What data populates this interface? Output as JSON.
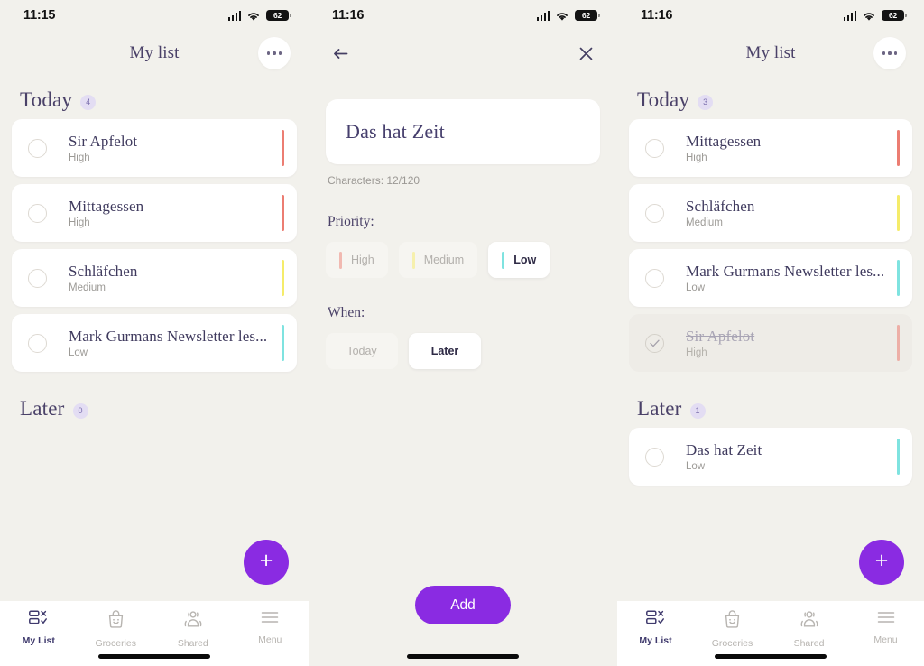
{
  "colors": {
    "bg": "#f2f1ec",
    "card": "#ffffff",
    "accent_purple": "#8a2be2",
    "title_ink": "#4a4168",
    "priority_high": "#ec7d72",
    "priority_medium": "#f5ec6a",
    "priority_low": "#7fe3e0"
  },
  "panels": [
    {
      "id": "list-before",
      "statusbar": {
        "time": "11:15",
        "battery": "62",
        "signal_icon": "cellular-signal-icon",
        "wifi_icon": "wifi-icon",
        "battery_icon": "battery-icon"
      },
      "topbar": {
        "title": "My list",
        "menu_icon": "more-dots-icon"
      },
      "sections": [
        {
          "title": "Today",
          "count": "4",
          "tasks": [
            {
              "title": "Sir Apfelot",
              "priority": "High",
              "color": "#ec7d72",
              "done": false
            },
            {
              "title": "Mittagessen",
              "priority": "High",
              "color": "#ec7d72",
              "done": false
            },
            {
              "title": "Schläfchen",
              "priority": "Medium",
              "color": "#f5ec6a",
              "done": false
            },
            {
              "title": "Mark Gurmans Newsletter les...",
              "priority": "Low",
              "color": "#7fe3e0",
              "done": false
            }
          ]
        },
        {
          "title": "Later",
          "count": "0",
          "tasks": []
        }
      ],
      "fab_label": "+",
      "nav": [
        {
          "label": "My List",
          "icon": "my-list-icon",
          "active": true
        },
        {
          "label": "Groceries",
          "icon": "groceries-bag-icon",
          "active": false
        },
        {
          "label": "Shared",
          "icon": "shared-people-icon",
          "active": false
        },
        {
          "label": "Menu",
          "icon": "hamburger-menu-icon",
          "active": false
        }
      ]
    },
    {
      "id": "add-task-form",
      "statusbar": {
        "time": "11:16",
        "battery": "62",
        "signal_icon": "cellular-signal-icon",
        "wifi_icon": "wifi-icon",
        "battery_icon": "battery-icon"
      },
      "topbar": {
        "back_icon": "arrow-left-icon",
        "close_icon": "close-x-icon"
      },
      "form": {
        "task_value": "Das hat Zeit",
        "task_placeholder": "Das hat Zeit",
        "char_count": "Characters: 12/120",
        "priority_label": "Priority:",
        "priority_options": [
          {
            "label": "High",
            "color": "#ec7d72",
            "selected": false
          },
          {
            "label": "Medium",
            "color": "#f5ec6a",
            "selected": false
          },
          {
            "label": "Low",
            "color": "#7fe3e0",
            "selected": true
          }
        ],
        "when_label": "When:",
        "when_options": [
          {
            "label": "Today",
            "selected": false
          },
          {
            "label": "Later",
            "selected": true
          }
        ],
        "submit_label": "Add"
      }
    },
    {
      "id": "list-after",
      "statusbar": {
        "time": "11:16",
        "battery": "62",
        "signal_icon": "cellular-signal-icon",
        "wifi_icon": "wifi-icon",
        "battery_icon": "battery-icon"
      },
      "topbar": {
        "title": "My list",
        "menu_icon": "more-dots-icon"
      },
      "sections": [
        {
          "title": "Today",
          "count": "3",
          "tasks": [
            {
              "title": "Mittagessen",
              "priority": "High",
              "color": "#ec7d72",
              "done": false
            },
            {
              "title": "Schläfchen",
              "priority": "Medium",
              "color": "#f5ec6a",
              "done": false
            },
            {
              "title": "Mark Gurmans Newsletter les...",
              "priority": "Low",
              "color": "#7fe3e0",
              "done": false
            },
            {
              "title": "Sir Apfelot",
              "priority": "High",
              "color": "#ec7d72",
              "done": true
            }
          ]
        },
        {
          "title": "Later",
          "count": "1",
          "tasks": [
            {
              "title": "Das hat Zeit",
              "priority": "Low",
              "color": "#7fe3e0",
              "done": false
            }
          ]
        }
      ],
      "fab_label": "+",
      "nav": [
        {
          "label": "My List",
          "icon": "my-list-icon",
          "active": true
        },
        {
          "label": "Groceries",
          "icon": "groceries-bag-icon",
          "active": false
        },
        {
          "label": "Shared",
          "icon": "shared-people-icon",
          "active": false
        },
        {
          "label": "Menu",
          "icon": "hamburger-menu-icon",
          "active": false
        }
      ]
    }
  ]
}
